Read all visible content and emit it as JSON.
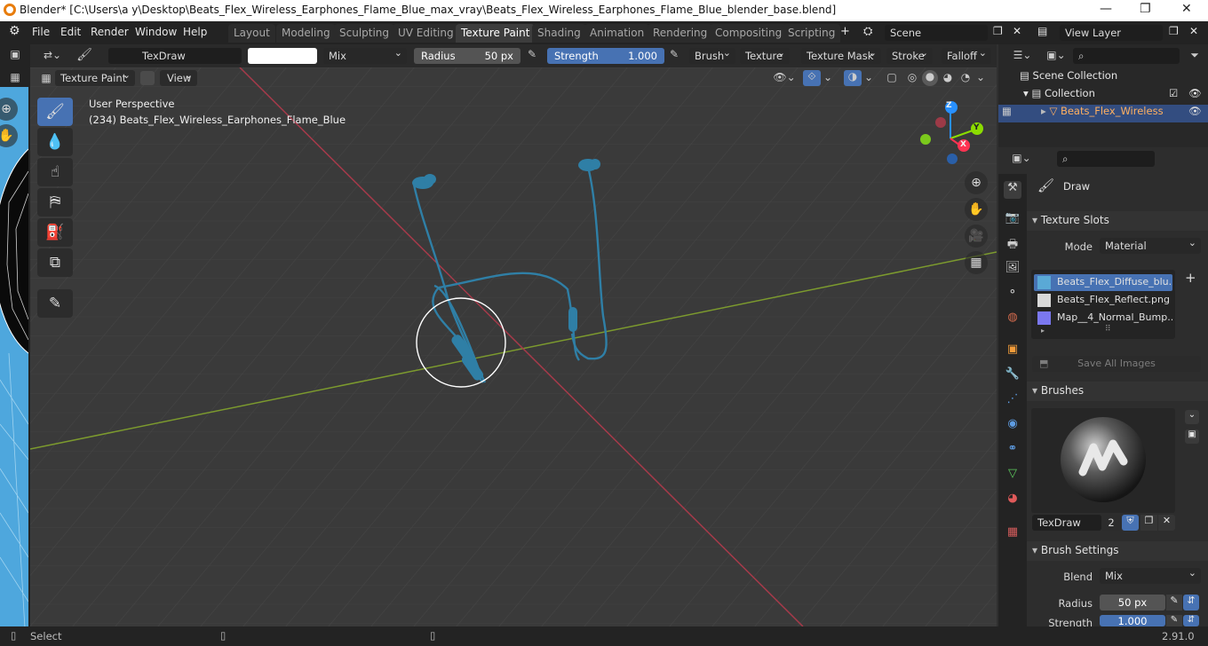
{
  "window": {
    "title": "Blender* [C:\\Users\\a y\\Desktop\\Beats_Flex_Wireless_Earphones_Flame_Blue_max_vray\\Beats_Flex_Wireless_Earphones_Flame_Blue_blender_base.blend]"
  },
  "menu": {
    "items": [
      "File",
      "Edit",
      "Render",
      "Window",
      "Help"
    ]
  },
  "workspaces": [
    "Layout",
    "Modeling",
    "Sculpting",
    "UV Editing",
    "Texture Paint",
    "Shading",
    "Animation",
    "Rendering",
    "Compositing",
    "Scripting"
  ],
  "active_workspace": "Texture Paint",
  "scene": {
    "name": "Scene",
    "view_layer": "View Layer"
  },
  "tool_header": {
    "brush_name": "TexDraw",
    "blend": "Mix",
    "radius_label": "Radius",
    "radius_value": "50 px",
    "strength_label": "Strength",
    "strength_value": "1.000",
    "menus": [
      "Brush",
      "Texture",
      "Texture Mask",
      "Stroke",
      "Falloff"
    ]
  },
  "viewport_header": {
    "mode": "Texture Paint",
    "view": "View"
  },
  "viewport": {
    "perspective": "User Perspective",
    "object_info": "(234) Beats_Flex_Wireless_Earphones_Flame_Blue"
  },
  "outliner": {
    "scene_collection": "Scene Collection",
    "collection": "Collection",
    "object": "Beats_Flex_Wireless"
  },
  "properties": {
    "tool_name": "Draw",
    "texture_slots_header": "Texture Slots",
    "mode_label": "Mode",
    "mode_value": "Material",
    "slots": [
      {
        "name": "Beats_Flex_Diffuse_blu...",
        "color": "#5aa9d6",
        "active": true
      },
      {
        "name": "Beats_Flex_Reflect.png",
        "color": "#d9d9d9",
        "active": false
      },
      {
        "name": "Map__4_Normal_Bump....",
        "color": "#7b78f0",
        "active": false
      }
    ],
    "save_all": "Save All Images",
    "brushes_header": "Brushes",
    "brush_name": "TexDraw",
    "brush_users": "2",
    "brush_settings_header": "Brush Settings",
    "blend_label": "Blend",
    "blend_value": "Mix",
    "radius_label": "Radius",
    "radius_value": "50 px",
    "strength_label": "Strength",
    "strength_value": "1.000"
  },
  "statusbar": {
    "left": "Select",
    "version": "2.91.0"
  },
  "colors": {
    "accent": "#4772b3",
    "x_axis": "#ff3352",
    "y_axis": "#8bdc00",
    "z_axis": "#2890ff",
    "earphones": "#2f7fa6"
  }
}
